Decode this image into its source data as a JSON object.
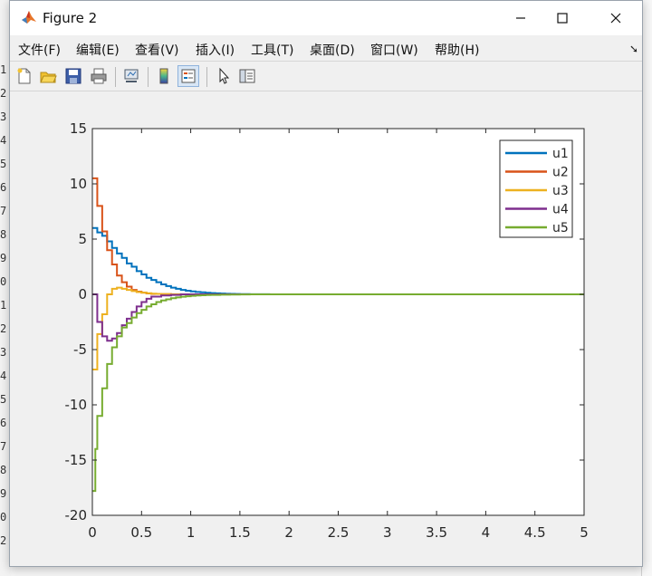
{
  "window": {
    "title": "Figure 2"
  },
  "menu": [
    {
      "label": "文件(F)"
    },
    {
      "label": "编辑(E)"
    },
    {
      "label": "查看(V)"
    },
    {
      "label": "插入(I)"
    },
    {
      "label": "工具(T)"
    },
    {
      "label": "桌面(D)"
    },
    {
      "label": "窗口(W)"
    },
    {
      "label": "帮助(H)"
    }
  ],
  "toolbar": [
    {
      "icon": "new-figure-icon"
    },
    {
      "icon": "open-file-icon"
    },
    {
      "icon": "save-icon"
    },
    {
      "icon": "print-icon"
    },
    {
      "icon": "link-plot-icon"
    },
    {
      "icon": "insert-colorbar-icon"
    },
    {
      "icon": "insert-legend-icon"
    },
    {
      "icon": "pointer-icon"
    },
    {
      "icon": "property-inspector-icon"
    }
  ],
  "background": {
    "line_numbers": [
      "1",
      "2",
      "3",
      "4",
      "5",
      "6",
      "7",
      "8",
      "9",
      "0",
      "1",
      "2",
      "3",
      "4",
      "5",
      "6",
      "7",
      "8",
      "9",
      "0",
      "2"
    ]
  },
  "colors": {
    "u1": "#0072BD",
    "u2": "#D95319",
    "u3": "#EDB120",
    "u4": "#7E2F8E",
    "u5": "#77AC30"
  },
  "chart_data": {
    "type": "line",
    "title": "",
    "xlabel": "",
    "ylabel": "",
    "xlim": [
      0,
      5
    ],
    "ylim": [
      -20,
      15
    ],
    "xticks": [
      "0",
      "0.5",
      "1",
      "1.5",
      "2",
      "2.5",
      "3",
      "3.5",
      "4",
      "4.5",
      "5"
    ],
    "yticks": [
      "15",
      "10",
      "5",
      "0",
      "-5",
      "-10",
      "-15",
      "-20"
    ],
    "grid": false,
    "legend": {
      "location": "top-right"
    },
    "step": true,
    "series": [
      {
        "name": "u1",
        "x": [
          0,
          0.05,
          0.1,
          0.15,
          0.2,
          0.25,
          0.3,
          0.35,
          0.4,
          0.45,
          0.5,
          0.55,
          0.6,
          0.65,
          0.7,
          0.75,
          0.8,
          0.85,
          0.9,
          0.95,
          1.0,
          1.05,
          1.1,
          1.15,
          1.2,
          1.25,
          1.3,
          1.35,
          1.4,
          1.45,
          1.5,
          1.6,
          1.8,
          2.0,
          5.0
        ],
        "y": [
          6.0,
          5.6,
          5.3,
          4.8,
          4.2,
          3.7,
          3.3,
          2.8,
          2.5,
          2.1,
          1.8,
          1.5,
          1.3,
          1.1,
          0.9,
          0.75,
          0.6,
          0.5,
          0.4,
          0.33,
          0.27,
          0.22,
          0.18,
          0.14,
          0.11,
          0.09,
          0.07,
          0.05,
          0.04,
          0.03,
          0.02,
          0.01,
          0.0,
          0.0,
          0.0
        ]
      },
      {
        "name": "u2",
        "x": [
          0,
          0.05,
          0.1,
          0.15,
          0.2,
          0.25,
          0.3,
          0.35,
          0.4,
          0.45,
          0.5,
          0.55,
          0.6,
          0.7,
          0.8,
          0.9,
          1.0,
          1.2,
          1.5,
          5.0
        ],
        "y": [
          10.5,
          8.0,
          5.7,
          4.0,
          2.7,
          1.7,
          1.1,
          0.7,
          0.4,
          0.25,
          0.15,
          0.08,
          0.04,
          0.02,
          0.0,
          0.0,
          0.0,
          0.0,
          0.0,
          0.0
        ]
      },
      {
        "name": "u3",
        "x": [
          0,
          0.05,
          0.1,
          0.15,
          0.2,
          0.25,
          0.3,
          0.35,
          0.4,
          0.45,
          0.5,
          0.55,
          0.6,
          0.65,
          0.7,
          0.8,
          0.9,
          1.0,
          1.2,
          1.5,
          5.0
        ],
        "y": [
          -6.8,
          -3.6,
          -1.8,
          0.0,
          0.5,
          0.6,
          0.5,
          0.4,
          0.3,
          0.2,
          0.15,
          0.1,
          0.06,
          0.04,
          0.02,
          0.01,
          0.0,
          0.0,
          0.0,
          0.0,
          0.0
        ]
      },
      {
        "name": "u4",
        "x": [
          0,
          0.05,
          0.1,
          0.15,
          0.2,
          0.25,
          0.3,
          0.35,
          0.4,
          0.45,
          0.5,
          0.55,
          0.6,
          0.7,
          0.8,
          0.9,
          1.0,
          1.2,
          1.5,
          5.0
        ],
        "y": [
          0.0,
          -2.5,
          -3.8,
          -4.2,
          -4.0,
          -3.5,
          -2.8,
          -2.2,
          -1.6,
          -1.1,
          -0.7,
          -0.4,
          -0.2,
          -0.1,
          -0.05,
          0.0,
          0.0,
          0.0,
          0.0,
          0.0
        ]
      },
      {
        "name": "u5",
        "x": [
          0,
          0.03,
          0.05,
          0.1,
          0.15,
          0.2,
          0.25,
          0.3,
          0.35,
          0.4,
          0.45,
          0.5,
          0.55,
          0.6,
          0.65,
          0.7,
          0.75,
          0.8,
          0.85,
          0.9,
          0.95,
          1.0,
          1.05,
          1.1,
          1.15,
          1.2,
          1.3,
          1.4,
          1.5,
          1.6,
          1.8,
          2.0,
          5.0
        ],
        "y": [
          -17.8,
          -14.0,
          -11.0,
          -8.5,
          -6.3,
          -4.8,
          -3.8,
          -3.0,
          -2.6,
          -2.1,
          -1.7,
          -1.4,
          -1.1,
          -0.9,
          -0.7,
          -0.55,
          -0.45,
          -0.35,
          -0.28,
          -0.22,
          -0.17,
          -0.13,
          -0.1,
          -0.08,
          -0.06,
          -0.05,
          -0.03,
          -0.02,
          -0.01,
          0.0,
          0.0,
          0.0,
          0.0
        ]
      }
    ]
  }
}
